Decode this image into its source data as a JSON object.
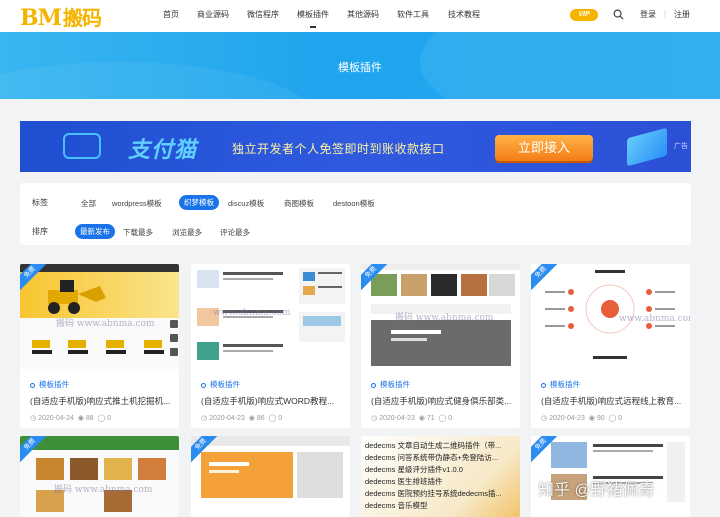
{
  "header": {
    "logo_latin": "BM",
    "logo_cn": "搬码",
    "nav": [
      "首页",
      "商业源码",
      "微信程序",
      "模板插件",
      "其他源码",
      "软件工具",
      "技术教程"
    ],
    "vip": "VIP",
    "login": "登录",
    "register": "注册"
  },
  "hero": {
    "title": "模板插件"
  },
  "banner": {
    "brand": "支付猫",
    "slogan": "独立开发者个人免签即时到账收款接口",
    "cta": "立即接入",
    "ad_tag": "广告"
  },
  "filter": {
    "tag_label": "标签",
    "tags": [
      "全部",
      "wordpress模板",
      "织梦模板",
      "discuz模板",
      "商图模板",
      "destoon模板"
    ],
    "active_tag": "织梦模板",
    "sort_label": "排序",
    "sorts": [
      "最新发布",
      "下载最多",
      "浏览最多",
      "评论最多"
    ],
    "active_sort": "最新发布"
  },
  "cards": [
    {
      "badge": "免费",
      "category": "模板插件",
      "title": "(自适应手机版)响应式推土机挖掘机...",
      "date": "2020-04-24",
      "views": "88",
      "comments": "0"
    },
    {
      "badge": "",
      "category": "模板插件",
      "title": "(自适应手机版)响应式WORD教程...",
      "date": "2020-04-23",
      "views": "86",
      "comments": "0"
    },
    {
      "badge": "免费",
      "category": "模板插件",
      "title": "(自适应手机版)响应式健身俱乐部类...",
      "date": "2020-04-23",
      "views": "71",
      "comments": "0"
    },
    {
      "badge": "免费",
      "category": "模板插件",
      "title": "(自适应手机版)响应式远程线上教育...",
      "date": "2020-04-23",
      "views": "90",
      "comments": "0"
    }
  ],
  "row2_badges": [
    "免费",
    "免费",
    "",
    "免费"
  ],
  "dedecms_list": [
    "dedecms 文章自动生成二维码插件（带...",
    "dedecms 问答系统带伪静态+免登陆访...",
    "dedecms 星级评分插件v1.0.0",
    "dedecms 医生排班插件",
    "dedecms 医院预约挂号系统dedecms插...",
    "dedecms 音乐模型"
  ],
  "watermarks": [
    "搬码 www.abnma.com",
    "www.abnma.com",
    "搬码 www.abnma.com",
    "www.abnma.com",
    "搬码 www.abnma.com"
  ],
  "zhihu_watermark": "知乎 @野猪佩奇",
  "colors": {
    "accent": "#1a73e8",
    "logo": "#f5b400",
    "hero": "#21a9f0"
  }
}
